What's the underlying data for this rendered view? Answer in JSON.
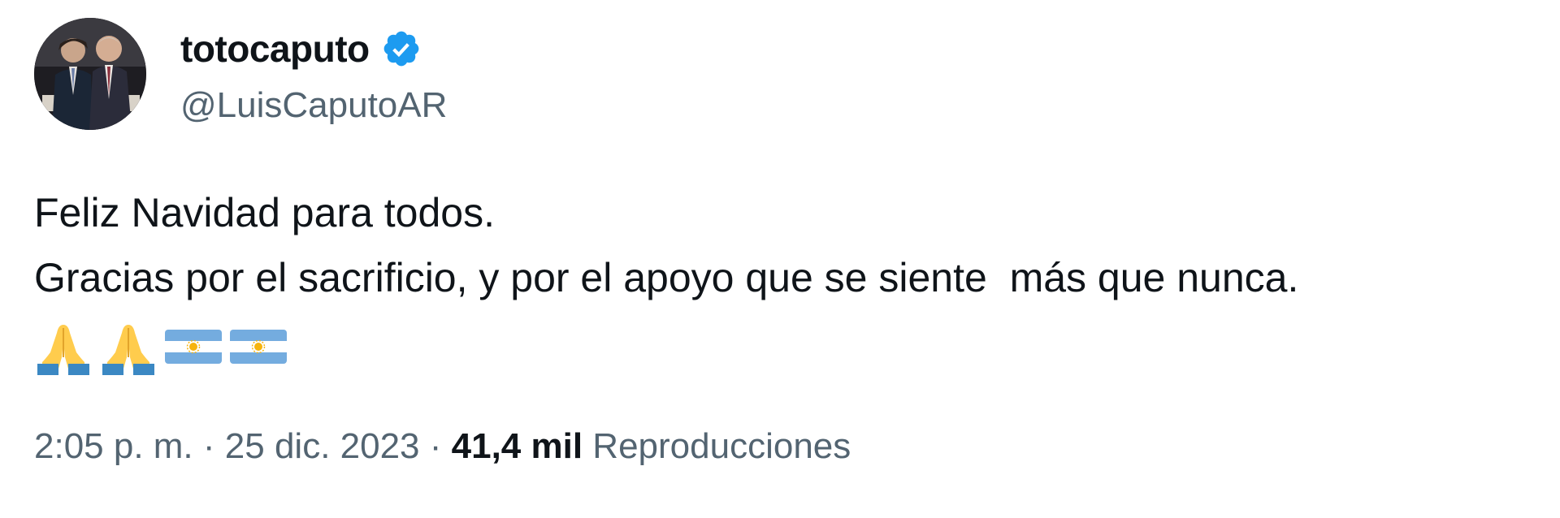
{
  "author": {
    "display_name": "totocaputo",
    "handle": "@LuisCaputoAR",
    "verified": true,
    "avatar_icon": "profile-photo-avatar"
  },
  "tweet": {
    "lines": [
      "Feliz Navidad para todos.",
      "Gracias por el sacrificio, y por el apoyo que se siente  más que nunca."
    ],
    "emojis": [
      "folded-hands-icon",
      "folded-hands-icon",
      "argentina-flag-icon",
      "argentina-flag-icon"
    ]
  },
  "meta": {
    "time": "2:05 p. m.",
    "separator": " · ",
    "date": "25 dic. 2023",
    "views_count": "41,4 mil",
    "views_label": " Reproducciones"
  },
  "colors": {
    "text_primary": "#0f1419",
    "text_secondary": "#536471",
    "verified_blue": "#1d9bf0",
    "flag_blue": "#74acdf",
    "sun_gold": "#f6b40e"
  }
}
